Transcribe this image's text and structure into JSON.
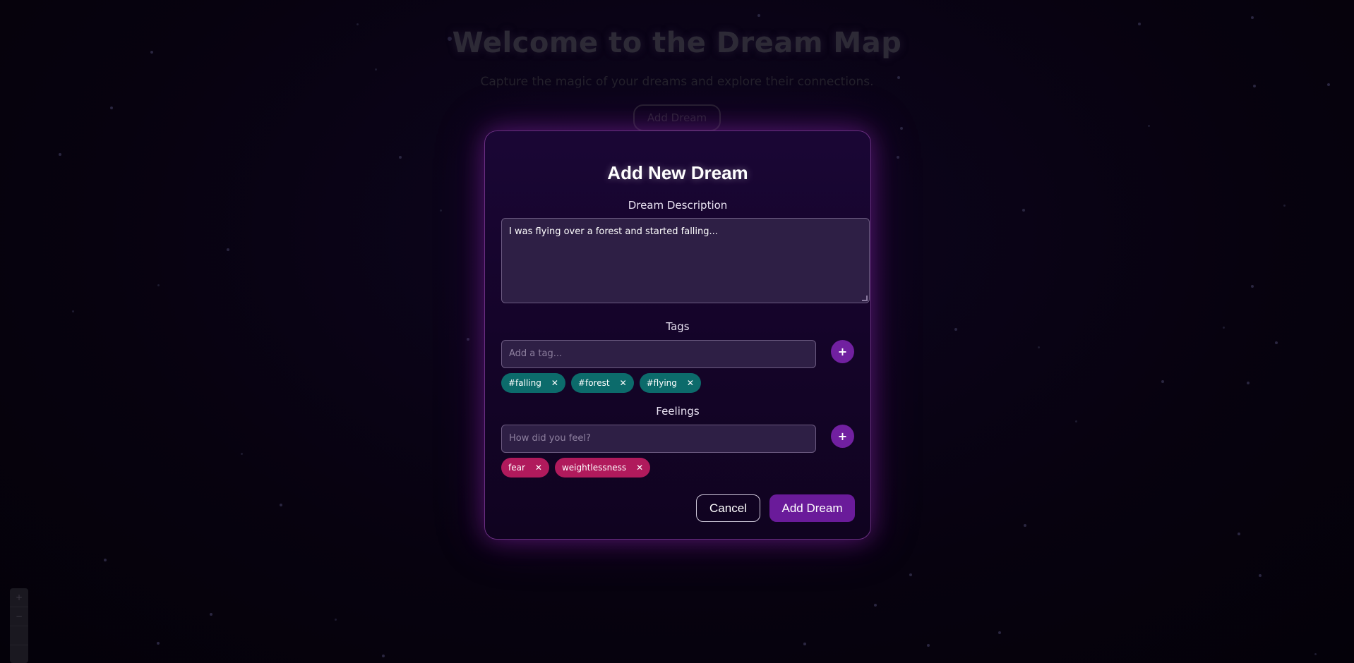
{
  "background": {
    "title": "Welcome to the Dream Map",
    "subtitle": "Capture the magic of your dreams and explore their connections.",
    "add_button": "Add Dream",
    "map_controls": [
      "+",
      "−",
      "",
      ""
    ]
  },
  "modal": {
    "title": "Add New Dream",
    "description": {
      "label": "Dream Description",
      "value": "I was flying over a forest and started falling..."
    },
    "tags": {
      "label": "Tags",
      "placeholder": "Add a tag...",
      "add_icon": "+",
      "items": [
        "#falling",
        "#forest",
        "#flying"
      ],
      "remove_icon": "✕"
    },
    "feelings": {
      "label": "Feelings",
      "placeholder": "How did you feel?",
      "add_icon": "+",
      "items": [
        "fear",
        "weightlessness"
      ],
      "remove_icon": "✕"
    },
    "buttons": {
      "cancel": "Cancel",
      "submit": "Add Dream"
    }
  },
  "colors": {
    "accent": "#6a1b9a",
    "tag_chip": "#0c6b6b",
    "feeling_chip": "#b01a5c",
    "modal_border": "#6a2f82"
  }
}
